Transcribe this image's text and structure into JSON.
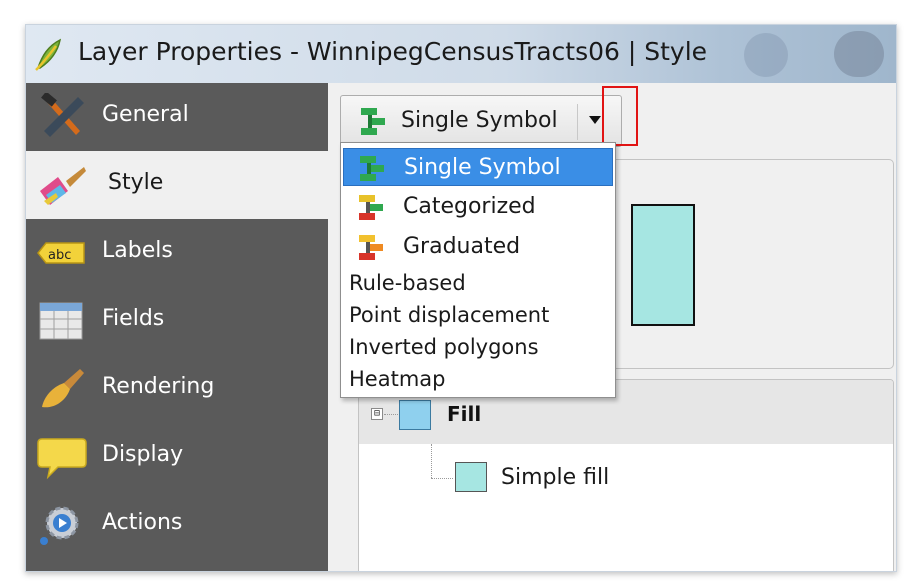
{
  "window": {
    "title": "Layer Properties - WinnipegCensusTracts06 | Style",
    "title_icon": "qgis-leaf-icon"
  },
  "sidebar": {
    "items": [
      {
        "label": "General",
        "icon": "hammer-wrench-icon",
        "active": false
      },
      {
        "label": "Style",
        "icon": "paintbrush-icon",
        "active": true
      },
      {
        "label": "Labels",
        "icon": "abc-label-icon",
        "active": false
      },
      {
        "label": "Fields",
        "icon": "table-icon",
        "active": false
      },
      {
        "label": "Rendering",
        "icon": "brush-icon",
        "active": false
      },
      {
        "label": "Display",
        "icon": "speech-bubble-icon",
        "active": false
      },
      {
        "label": "Actions",
        "icon": "gear-play-icon",
        "active": false
      }
    ]
  },
  "renderer": {
    "selected_label": "Single Symbol",
    "icon": "single-symbol-icon",
    "options_with_icons": [
      {
        "label": "Single Symbol",
        "icon": "single-symbol-icon",
        "selected": true
      },
      {
        "label": "Categorized",
        "icon": "categorized-icon",
        "selected": false
      },
      {
        "label": "Graduated",
        "icon": "graduated-icon",
        "selected": false
      }
    ],
    "options_plain": [
      "Rule-based",
      "Point displacement",
      "Inverted polygons",
      "Heatmap"
    ]
  },
  "symbol_tree": {
    "root_label": "Fill",
    "root_expander": "⊟",
    "child_label": "Simple fill"
  },
  "colors": {
    "fill_swatch": "#8fd0ee",
    "simple_fill_swatch": "#a6e6e2",
    "selection": "#3a8ee6",
    "highlight_box": "#e11414",
    "sidebar_bg": "#5a5a5a"
  }
}
